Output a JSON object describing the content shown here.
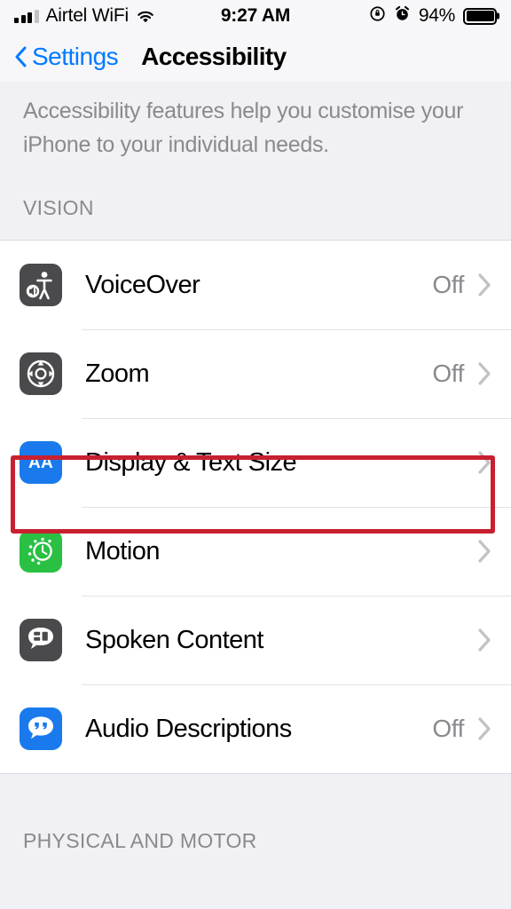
{
  "status_bar": {
    "carrier": "Airtel WiFi",
    "wifi_icon": "wifi-icon",
    "signal_icon": "signal-bars-icon",
    "time": "9:27 AM",
    "rotation_lock_icon": "rotation-lock-icon",
    "alarm_icon": "alarm-clock-icon",
    "battery_percent": "94%",
    "battery_icon": "battery-full-icon"
  },
  "nav_bar": {
    "back_label": "Settings",
    "back_icon": "chevron-left-icon",
    "title": "Accessibility"
  },
  "description": "Accessibility features help you customise your iPhone to your individual needs.",
  "sections": [
    {
      "header": "VISION",
      "rows": [
        {
          "label": "VoiceOver",
          "value": "Off",
          "icon": "voiceover-icon",
          "icon_color": "#4a4a4d",
          "name": "row-voiceover"
        },
        {
          "label": "Zoom",
          "value": "Off",
          "icon": "zoom-icon",
          "icon_color": "#4a4a4d",
          "name": "row-zoom"
        },
        {
          "label": "Display & Text Size",
          "value": "",
          "icon": "display-text-size-icon",
          "icon_color": "#1a7aed",
          "name": "row-display-text-size"
        },
        {
          "label": "Motion",
          "value": "",
          "icon": "motion-icon",
          "icon_color": "#29c043",
          "name": "row-motion"
        },
        {
          "label": "Spoken Content",
          "value": "",
          "icon": "spoken-content-icon",
          "icon_color": "#4a4a4d",
          "name": "row-spoken-content"
        },
        {
          "label": "Audio Descriptions",
          "value": "Off",
          "icon": "audio-descriptions-icon",
          "icon_color": "#1a7aed",
          "name": "row-audio-descriptions"
        }
      ]
    },
    {
      "header": "PHYSICAL AND MOTOR",
      "rows": []
    }
  ],
  "highlight": {
    "target": "Display & Text Size",
    "color": "#c8202f"
  },
  "colors": {
    "accent_blue": "#007aff",
    "page_background": "#f1f1f5",
    "list_background": "#ffffff",
    "secondary_text": "#8a8a8e",
    "highlight_red": "#c8202f"
  }
}
